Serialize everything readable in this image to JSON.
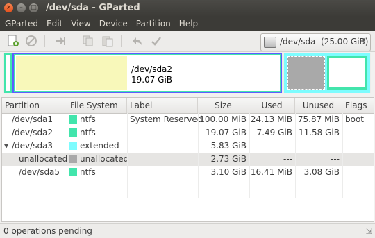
{
  "window": {
    "title": "/dev/sda - GParted"
  },
  "menubar": {
    "items": [
      "GParted",
      "Edit",
      "View",
      "Device",
      "Partition",
      "Help"
    ]
  },
  "device_selector": {
    "label": "/dev/sda  (25.00 GiB)"
  },
  "graphic": {
    "selected_name": "/dev/sda2",
    "selected_size": "19.07 GiB"
  },
  "colors": {
    "ntfs": "#42e5ac",
    "extended": "#7dfcfe",
    "unallocated": "#a9a9a9",
    "used": "#f8f8ba",
    "selection": "#5d5dff"
  },
  "table": {
    "headers": [
      "Partition",
      "File System",
      "Label",
      "Size",
      "Used",
      "Unused",
      "Flags"
    ],
    "rows": [
      {
        "partition": "/dev/sda1",
        "fs": "ntfs",
        "label": "System Reserved",
        "size": "100.00 MiB",
        "used": "24.13 MiB",
        "unused": "75.87 MiB",
        "flags": "boot"
      },
      {
        "partition": "/dev/sda2",
        "fs": "ntfs",
        "label": "",
        "size": "19.07 GiB",
        "used": "7.49 GiB",
        "unused": "11.58 GiB",
        "flags": ""
      },
      {
        "partition": "/dev/sda3",
        "fs": "extended",
        "label": "",
        "size": "5.83 GiB",
        "used": "---",
        "unused": "---",
        "flags": ""
      },
      {
        "partition": "unallocated",
        "fs": "unallocated",
        "label": "",
        "size": "2.73 GiB",
        "used": "---",
        "unused": "---",
        "flags": ""
      },
      {
        "partition": "/dev/sda5",
        "fs": "ntfs",
        "label": "",
        "size": "3.10 GiB",
        "used": "16.41 MiB",
        "unused": "3.08 GiB",
        "flags": ""
      }
    ]
  },
  "status": {
    "text": "0 operations pending"
  }
}
